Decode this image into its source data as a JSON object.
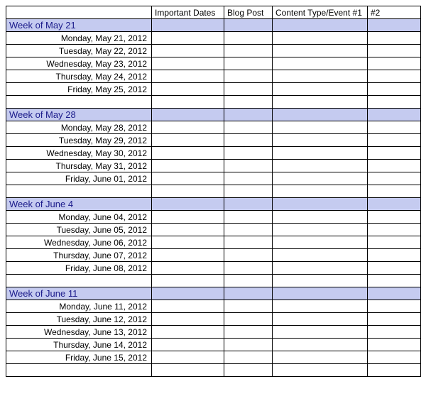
{
  "headers": {
    "col_date": "",
    "col_important": "Important Dates",
    "col_blog": "Blog Post",
    "col_content": "Content Type/Event #1",
    "col_num2": "#2"
  },
  "weeks": [
    {
      "label": "Week of May 21",
      "days": [
        "Monday, May 21, 2012",
        "Tuesday, May 22, 2012",
        "Wednesday, May 23, 2012",
        "Thursday, May 24, 2012",
        "Friday, May 25, 2012"
      ]
    },
    {
      "label": "Week of May 28",
      "days": [
        "Monday, May 28, 2012",
        "Tuesday, May 29, 2012",
        "Wednesday, May 30, 2012",
        "Thursday, May 31, 2012",
        "Friday, June 01, 2012"
      ]
    },
    {
      "label": "Week of June 4",
      "days": [
        "Monday, June 04, 2012",
        "Tuesday, June 05, 2012",
        "Wednesday, June 06, 2012",
        "Thursday, June 07, 2012",
        "Friday, June 08, 2012"
      ]
    },
    {
      "label": "Week of June 11",
      "days": [
        "Monday, June 11, 2012",
        "Tuesday, June 12, 2012",
        "Wednesday, June 13, 2012",
        "Thursday, June 14, 2012",
        "Friday, June 15, 2012"
      ]
    }
  ]
}
